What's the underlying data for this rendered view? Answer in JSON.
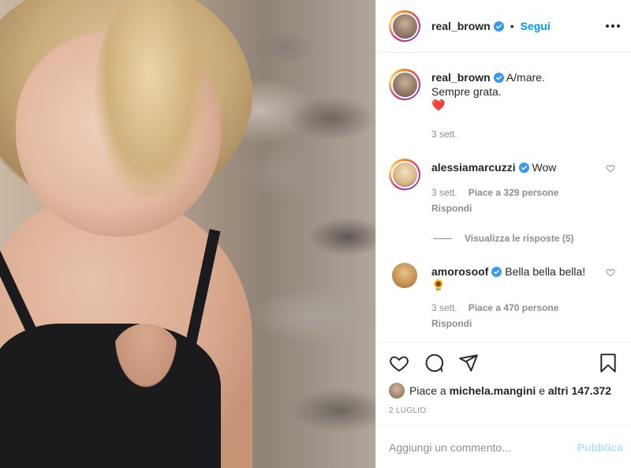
{
  "post": {
    "author": "real_brown",
    "follow_label": "Segui",
    "dot": "•",
    "caption_line1": "A/mare.",
    "caption_line2": "Sempre grata.",
    "caption_emoji": "❤️",
    "caption_time": "3 sett."
  },
  "comments": [
    {
      "user": "alessiamarcuzzi",
      "text": "Wow",
      "emoji": "",
      "time": "3 sett.",
      "likes": "Piace a 329 persone",
      "reply": "Rispondi",
      "view_replies": "Visualizza le risposte (5)"
    },
    {
      "user": "amorosoof",
      "text": "Bella bella bella!",
      "emoji": "🌻",
      "time": "3 sett.",
      "likes": "Piace a 470 persone",
      "reply": "Rispondi"
    }
  ],
  "likes_bar": {
    "prefix": "Piace a",
    "user": "michela.mangini",
    "joiner": "e",
    "others": "altri 147.372"
  },
  "date": "2 LUGLIO",
  "add_comment": {
    "placeholder": "Aggiungi un commento...",
    "publish": "Pubblica"
  },
  "colors": {
    "accent": "#0095f6",
    "heart": "#ed4956",
    "muted": "#8e8e8e",
    "publish_disabled": "#b2dffc"
  }
}
